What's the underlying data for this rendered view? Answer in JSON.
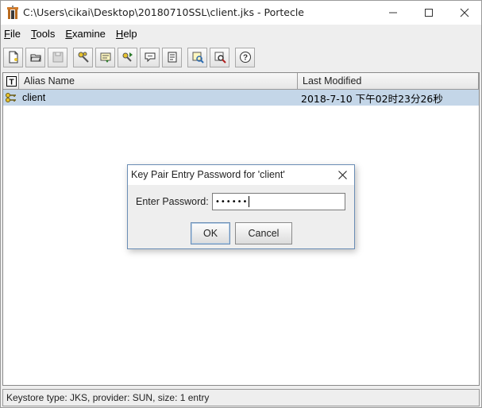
{
  "window": {
    "title": "C:\\Users\\cikai\\Desktop\\20180710SSL\\client.jks - Portecle",
    "minimize": "—",
    "maximize": "☐",
    "close": "✕"
  },
  "menu": {
    "items": [
      {
        "prefix": "",
        "accel": "F",
        "rest": "ile"
      },
      {
        "prefix": "",
        "accel": "T",
        "rest": "ools"
      },
      {
        "prefix": "",
        "accel": "E",
        "rest": "xamine"
      },
      {
        "prefix": "",
        "accel": "H",
        "rest": "elp"
      }
    ]
  },
  "toolbar": {
    "icons": [
      "new-keystore-icon",
      "open-keystore-icon",
      "save-keystore-icon",
      "generate-keypair-icon",
      "import-trusted-cert-icon",
      "import-keypair-icon",
      "set-password-icon",
      "keystore-report-icon",
      "examine-certificate-icon",
      "examine-crl-icon",
      "help-icon"
    ]
  },
  "table": {
    "type_header": "T",
    "alias_header": "Alias Name",
    "modified_header": "Last Modified",
    "rows": [
      {
        "alias": "client",
        "modified": "2018-7-10 下午02时23分26秒",
        "type_icon": "key-pair-icon"
      }
    ]
  },
  "status": {
    "text": "Keystore type: JKS, provider: SUN, size: 1 entry"
  },
  "dialog": {
    "title": "Key Pair Entry Password for 'client'",
    "close": "✕",
    "label": "Enter Password:",
    "password_mask": "••••••",
    "ok": "OK",
    "cancel": "Cancel"
  }
}
